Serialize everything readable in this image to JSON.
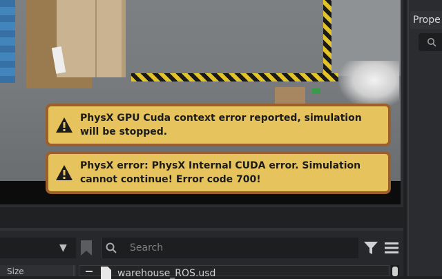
{
  "notifications": [
    {
      "icon": "warning-icon",
      "text": "PhysX GPU Cuda context error reported, simulation will be stopped."
    },
    {
      "icon": "warning-icon",
      "text": "PhysX error: PhysX Internal CUDA error. Simulation cannot continue! Error code 700!"
    }
  ],
  "properties_panel": {
    "tab_label": "Prope"
  },
  "browser": {
    "search_placeholder": "Search",
    "column_header": "Size",
    "tree_item": "warehouse_ROS.usd"
  },
  "colors": {
    "notification_bg": "#e6c35c",
    "notification_border": "#9c5f2c",
    "panel_bg": "#2a2c2f"
  }
}
